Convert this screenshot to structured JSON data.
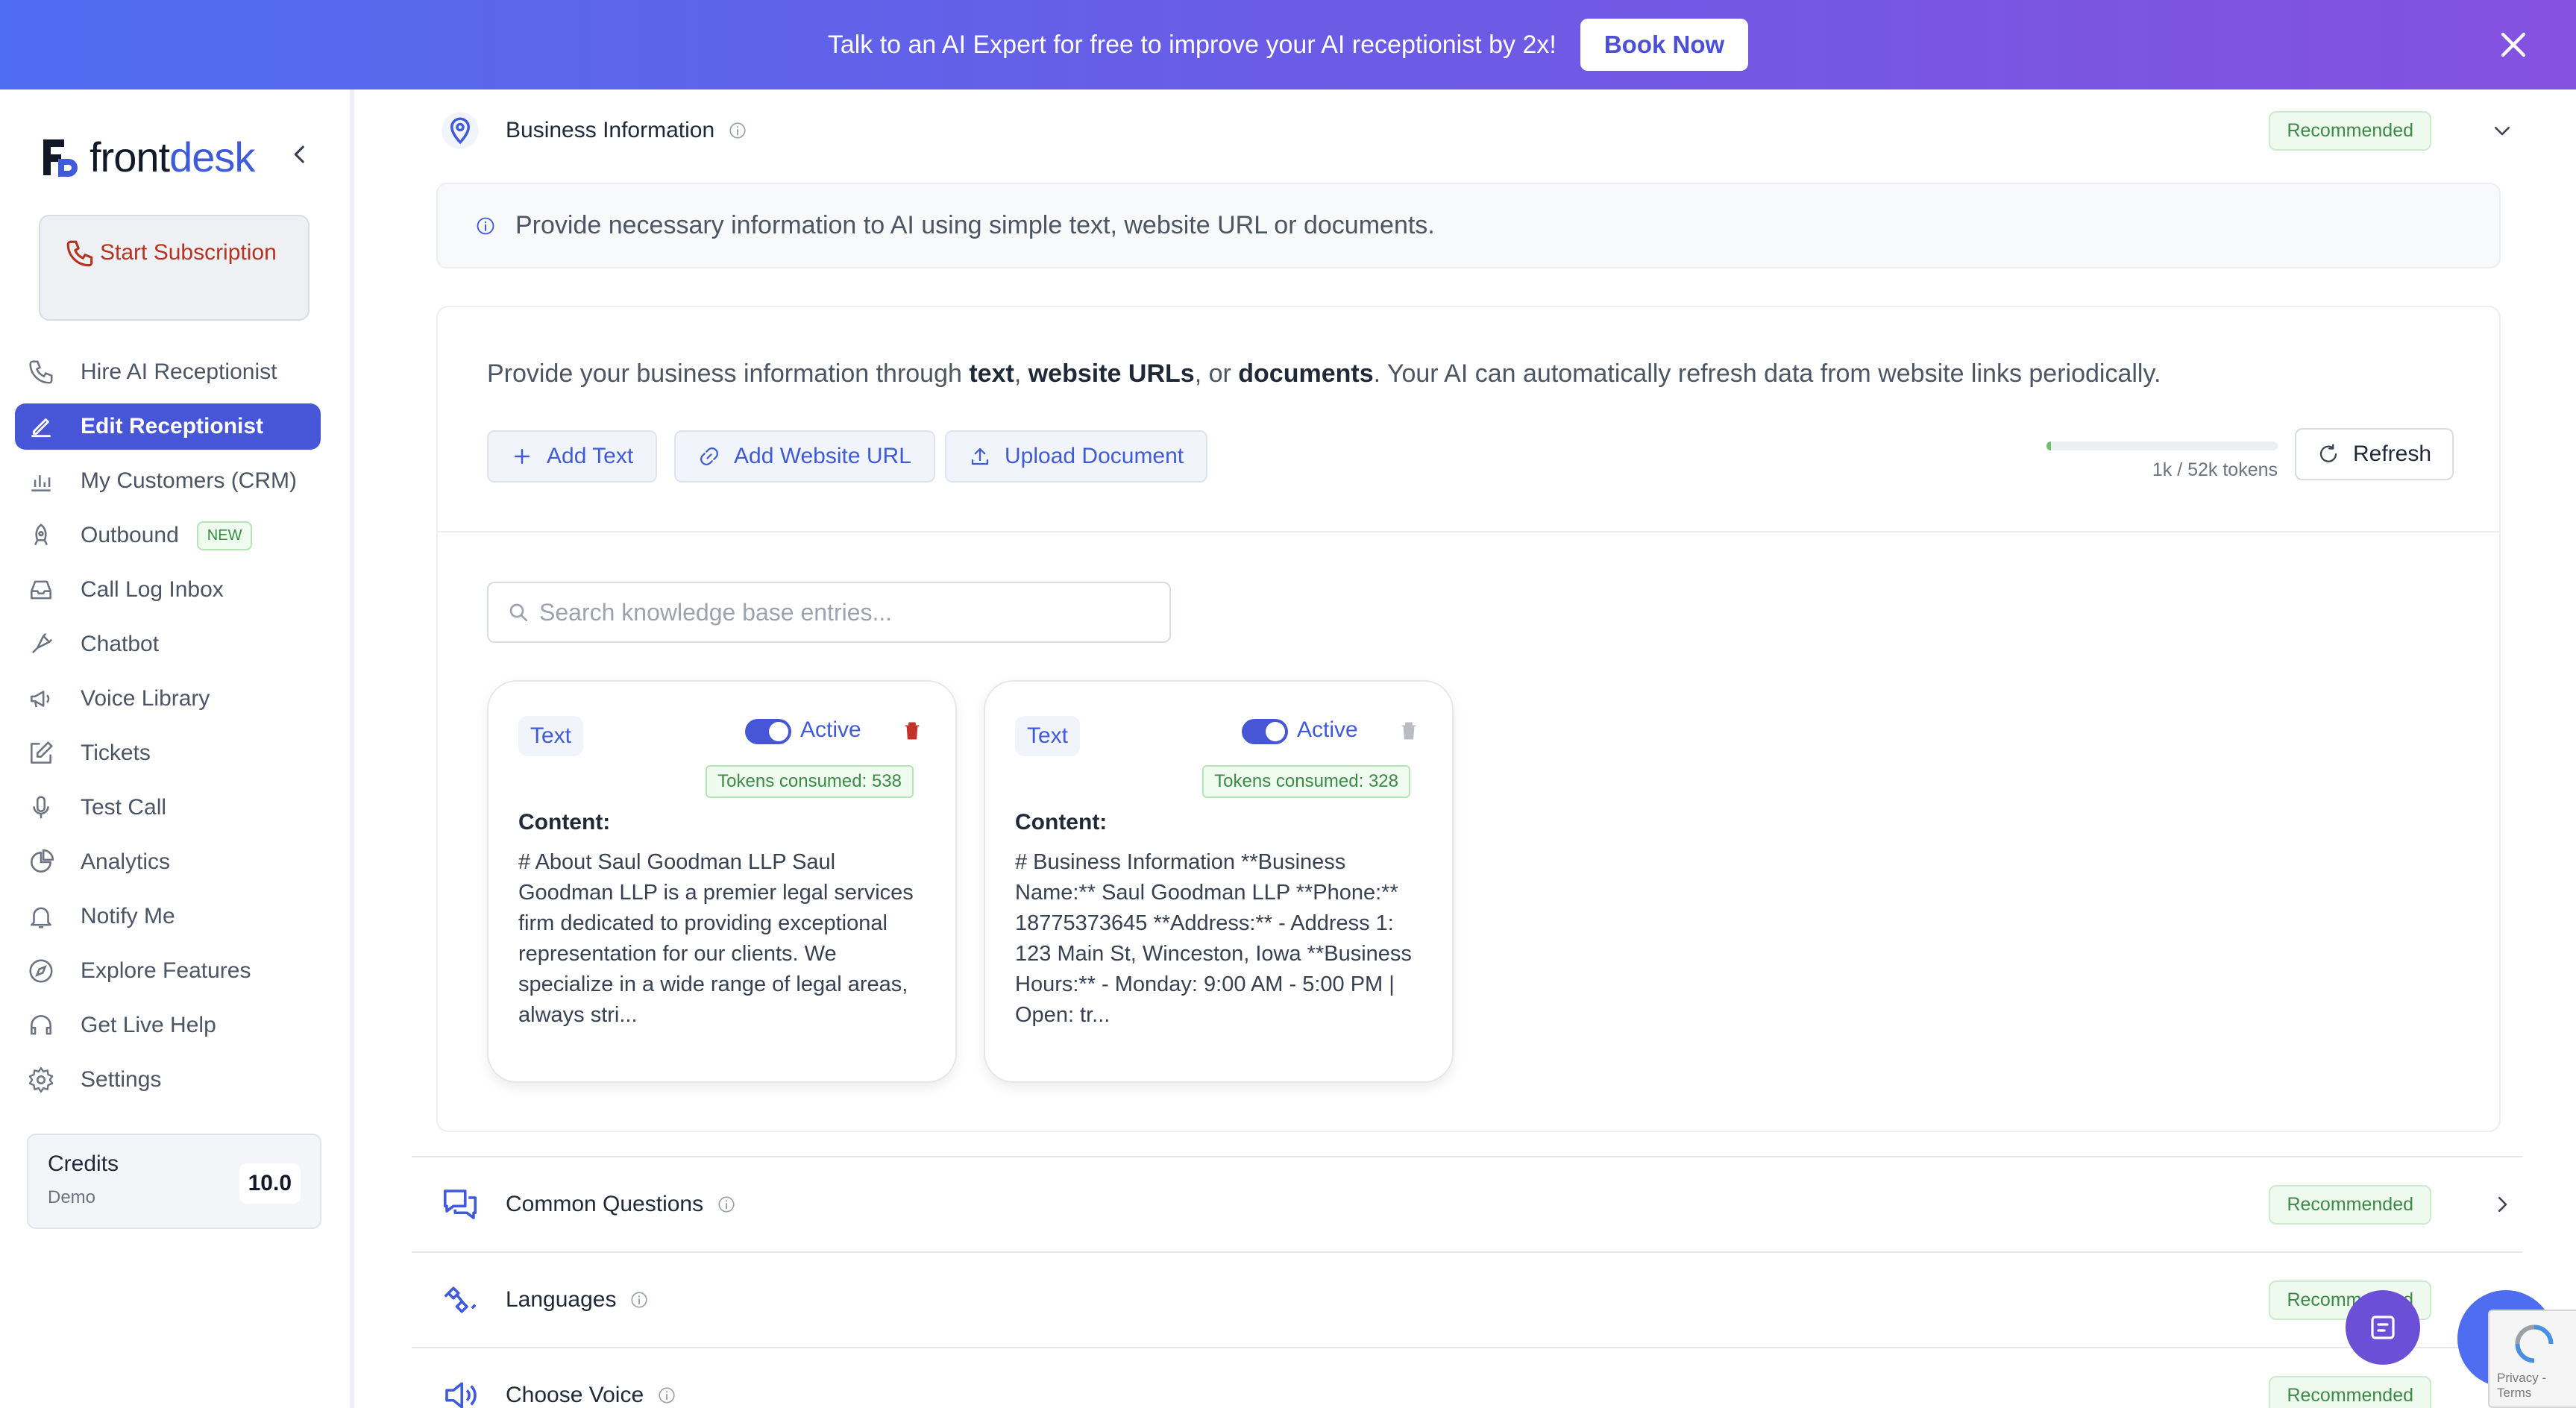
{
  "banner": {
    "text": "Talk to an AI Expert for free to improve your AI receptionist by 2x!",
    "button_label": "Book Now"
  },
  "brand": {
    "logo_text_front": "front",
    "logo_text_desk": "desk",
    "accent_color": "#4656d6"
  },
  "sidebar": {
    "start_subscription": "Start Subscription",
    "items": [
      {
        "label": "Hire AI Receptionist",
        "icon": "phone-outline-icon"
      },
      {
        "label": "Edit Receptionist",
        "icon": "pencil-icon",
        "active": true
      },
      {
        "label": "My Customers (CRM)",
        "icon": "bar-chart-icon"
      },
      {
        "label": "Outbound",
        "icon": "rocket-icon",
        "badge": "NEW"
      },
      {
        "label": "Call Log Inbox",
        "icon": "inbox-icon"
      },
      {
        "label": "Chatbot",
        "icon": "chatbot-icon"
      },
      {
        "label": "Voice Library",
        "icon": "megaphone-icon"
      },
      {
        "label": "Tickets",
        "icon": "edit-square-icon"
      },
      {
        "label": "Test Call",
        "icon": "microphone-icon"
      },
      {
        "label": "Analytics",
        "icon": "pie-chart-icon"
      },
      {
        "label": "Notify Me",
        "icon": "bell-icon"
      },
      {
        "label": "Explore Features",
        "icon": "compass-icon"
      },
      {
        "label": "Get Live Help",
        "icon": "headset-icon"
      },
      {
        "label": "Settings",
        "icon": "gear-icon"
      }
    ],
    "credits": {
      "title": "Credits",
      "subtitle": "Demo",
      "value": "10.0"
    }
  },
  "sections": {
    "business": {
      "title": "Business Information",
      "badge": "Recommended"
    },
    "common_questions": {
      "title": "Common Questions",
      "badge": "Recommended"
    },
    "languages": {
      "title": "Languages",
      "badge": "Recommended"
    },
    "choose_voice": {
      "title": "Choose Voice",
      "badge": "Recommended"
    }
  },
  "info_box": {
    "text": "Provide necessary information to AI using simple text, website URL or documents."
  },
  "panel": {
    "desc_1": "Provide your business information through ",
    "desc_b1": "text",
    "desc_2": ", ",
    "desc_b2": "website URLs",
    "desc_3": ", or ",
    "desc_b3": "documents",
    "desc_4": ". Your AI can automatically refresh data from website links periodically.",
    "add_text": "Add Text",
    "add_url": "Add Website URL",
    "upload_doc": "Upload Document",
    "tokens_label": "1k / 52k tokens",
    "tokens_fraction": 0.02,
    "refresh": "Refresh",
    "search_placeholder": "Search knowledge base entries..."
  },
  "cards": [
    {
      "type": "Text",
      "status": "Active",
      "tokens": "Tokens consumed: 538",
      "content_label": "Content:",
      "content": "# About Saul Goodman LLP Saul Goodman LLP is a premier legal services firm dedicated to providing exceptional representation for our clients. We specialize in a wide range of legal areas, always stri..."
    },
    {
      "type": "Text",
      "status": "Active",
      "tokens": "Tokens consumed: 328",
      "content_label": "Content:",
      "content": "# Business Information **Business Name:** Saul Goodman LLP **Phone:** 18775373645 **Address:** - Address 1: 123 Main St, Winceston, Iowa **Business Hours:** - Monday: 9:00 AM - 5:00 PM | Open: tr..."
    }
  ],
  "recaptcha_text": "Privacy - Terms"
}
